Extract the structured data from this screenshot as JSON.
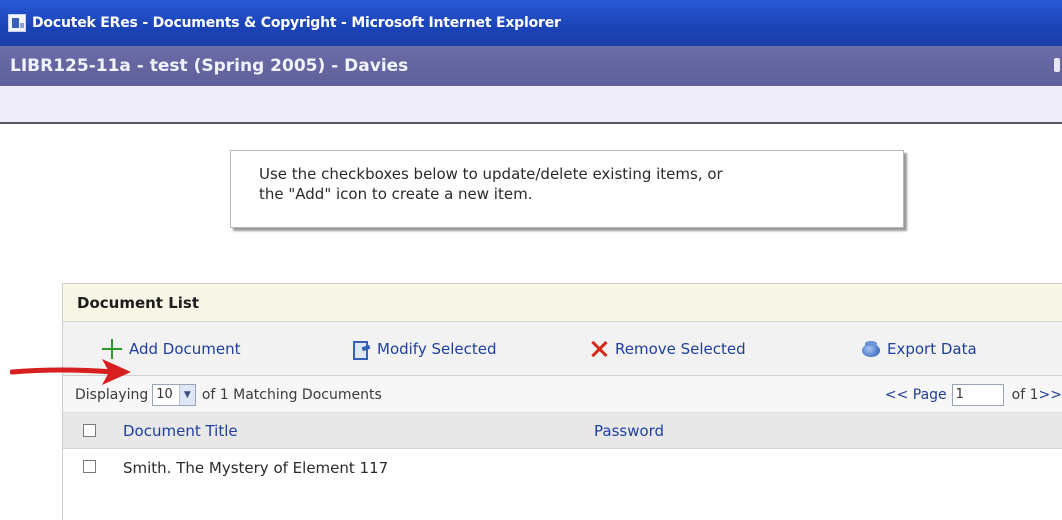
{
  "window": {
    "title": "Docutek ERes - Documents & Copyright - Microsoft Internet Explorer"
  },
  "course": {
    "title": "LIBR125-11a - test (Spring 2005) - Davies"
  },
  "info": {
    "line1": "Use the checkboxes below to update/delete existing items, or",
    "line2": "the \"Add\" icon to create a new item."
  },
  "panel": {
    "title": "Document List",
    "toolbar": {
      "add": "Add Document",
      "modify": "Modify Selected",
      "remove": "Remove Selected",
      "export": "Export Data"
    },
    "display": {
      "prefix": "Displaying",
      "per_page": "10",
      "suffix": "of 1 Matching Documents",
      "page_prev": "<< Page",
      "page_value": "1",
      "page_of": "of 1",
      "page_next": ">>"
    },
    "table": {
      "columns": [
        "Document Title",
        "Password"
      ],
      "rows": [
        {
          "title": "Smith. The Mystery of Element 117",
          "password": ""
        }
      ]
    }
  },
  "colors": {
    "titlebar": "#1b44b8",
    "course_bar": "#6b6ca8",
    "link": "#1f3f9c",
    "add_icon": "#2e9a2e",
    "remove_icon": "#d12a1a",
    "annotation_arrow": "#d61f1f"
  },
  "icons": {
    "add": "plus-icon",
    "modify": "modify-icon",
    "remove": "x-icon",
    "export": "export-icon"
  }
}
